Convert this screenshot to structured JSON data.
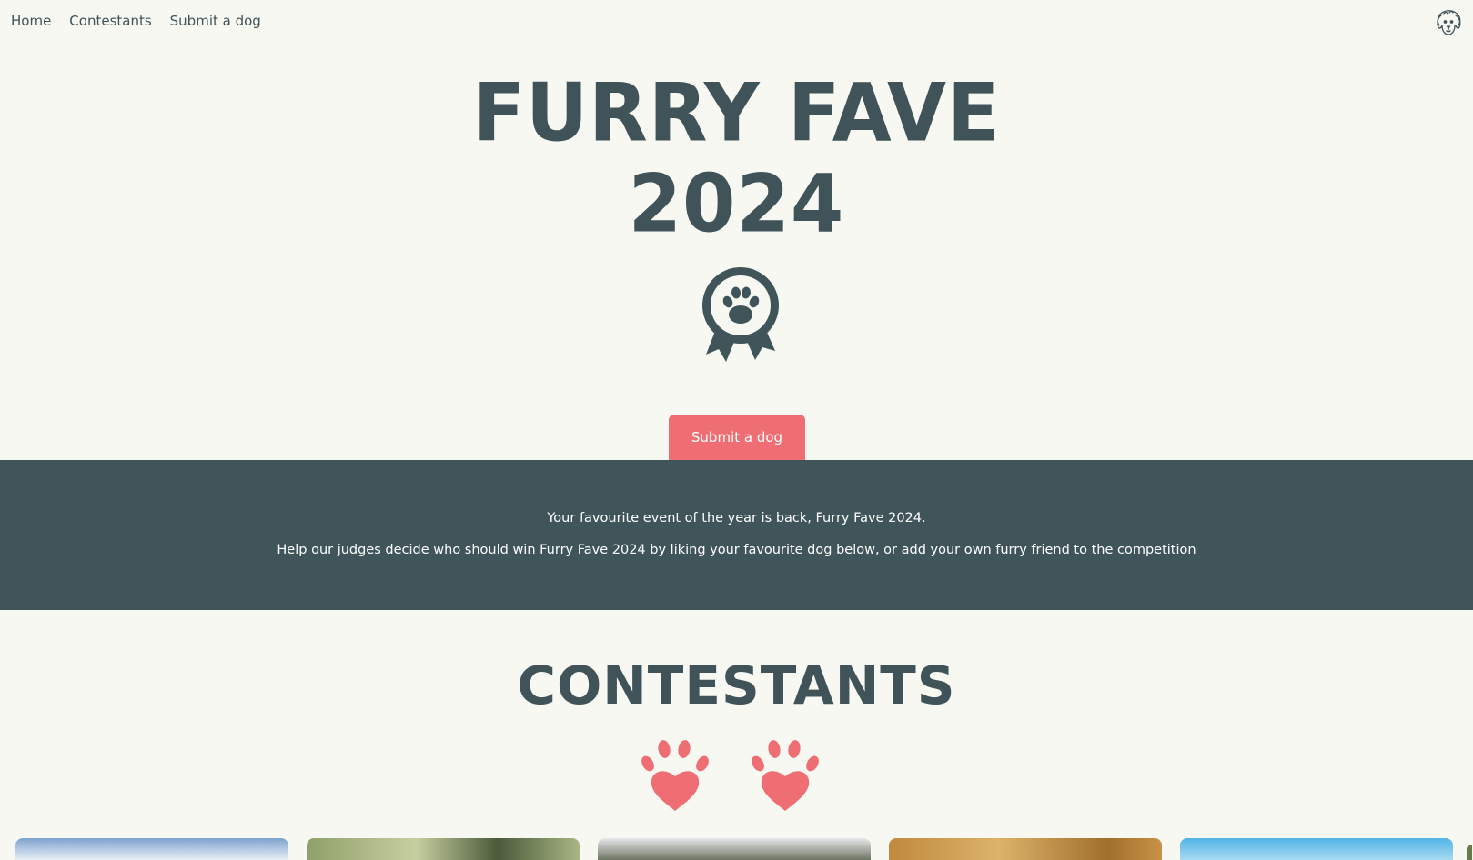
{
  "nav": {
    "links": [
      "Home",
      "Contestants",
      "Submit a dog"
    ],
    "logo_icon": "dog-face-icon"
  },
  "hero": {
    "title_line1": "FURRY FAVE",
    "title_line2": "2024",
    "badge_icon": "paw-rosette-icon",
    "cta_label": "Submit a dog"
  },
  "intro": {
    "line1": "Your favourite event of the year is back, Furry Fave 2024.",
    "line2": "Help our judges decide who should win Furry Fave 2024 by liking your favourite dog below, or add your own furry friend to the competition"
  },
  "contestants": {
    "title": "CONTESTANTS",
    "decor_icon": "paw-heart-icon"
  },
  "colors": {
    "primary_dark": "#40555a",
    "accent": "#ef6e74",
    "background": "#f8f8f3"
  }
}
